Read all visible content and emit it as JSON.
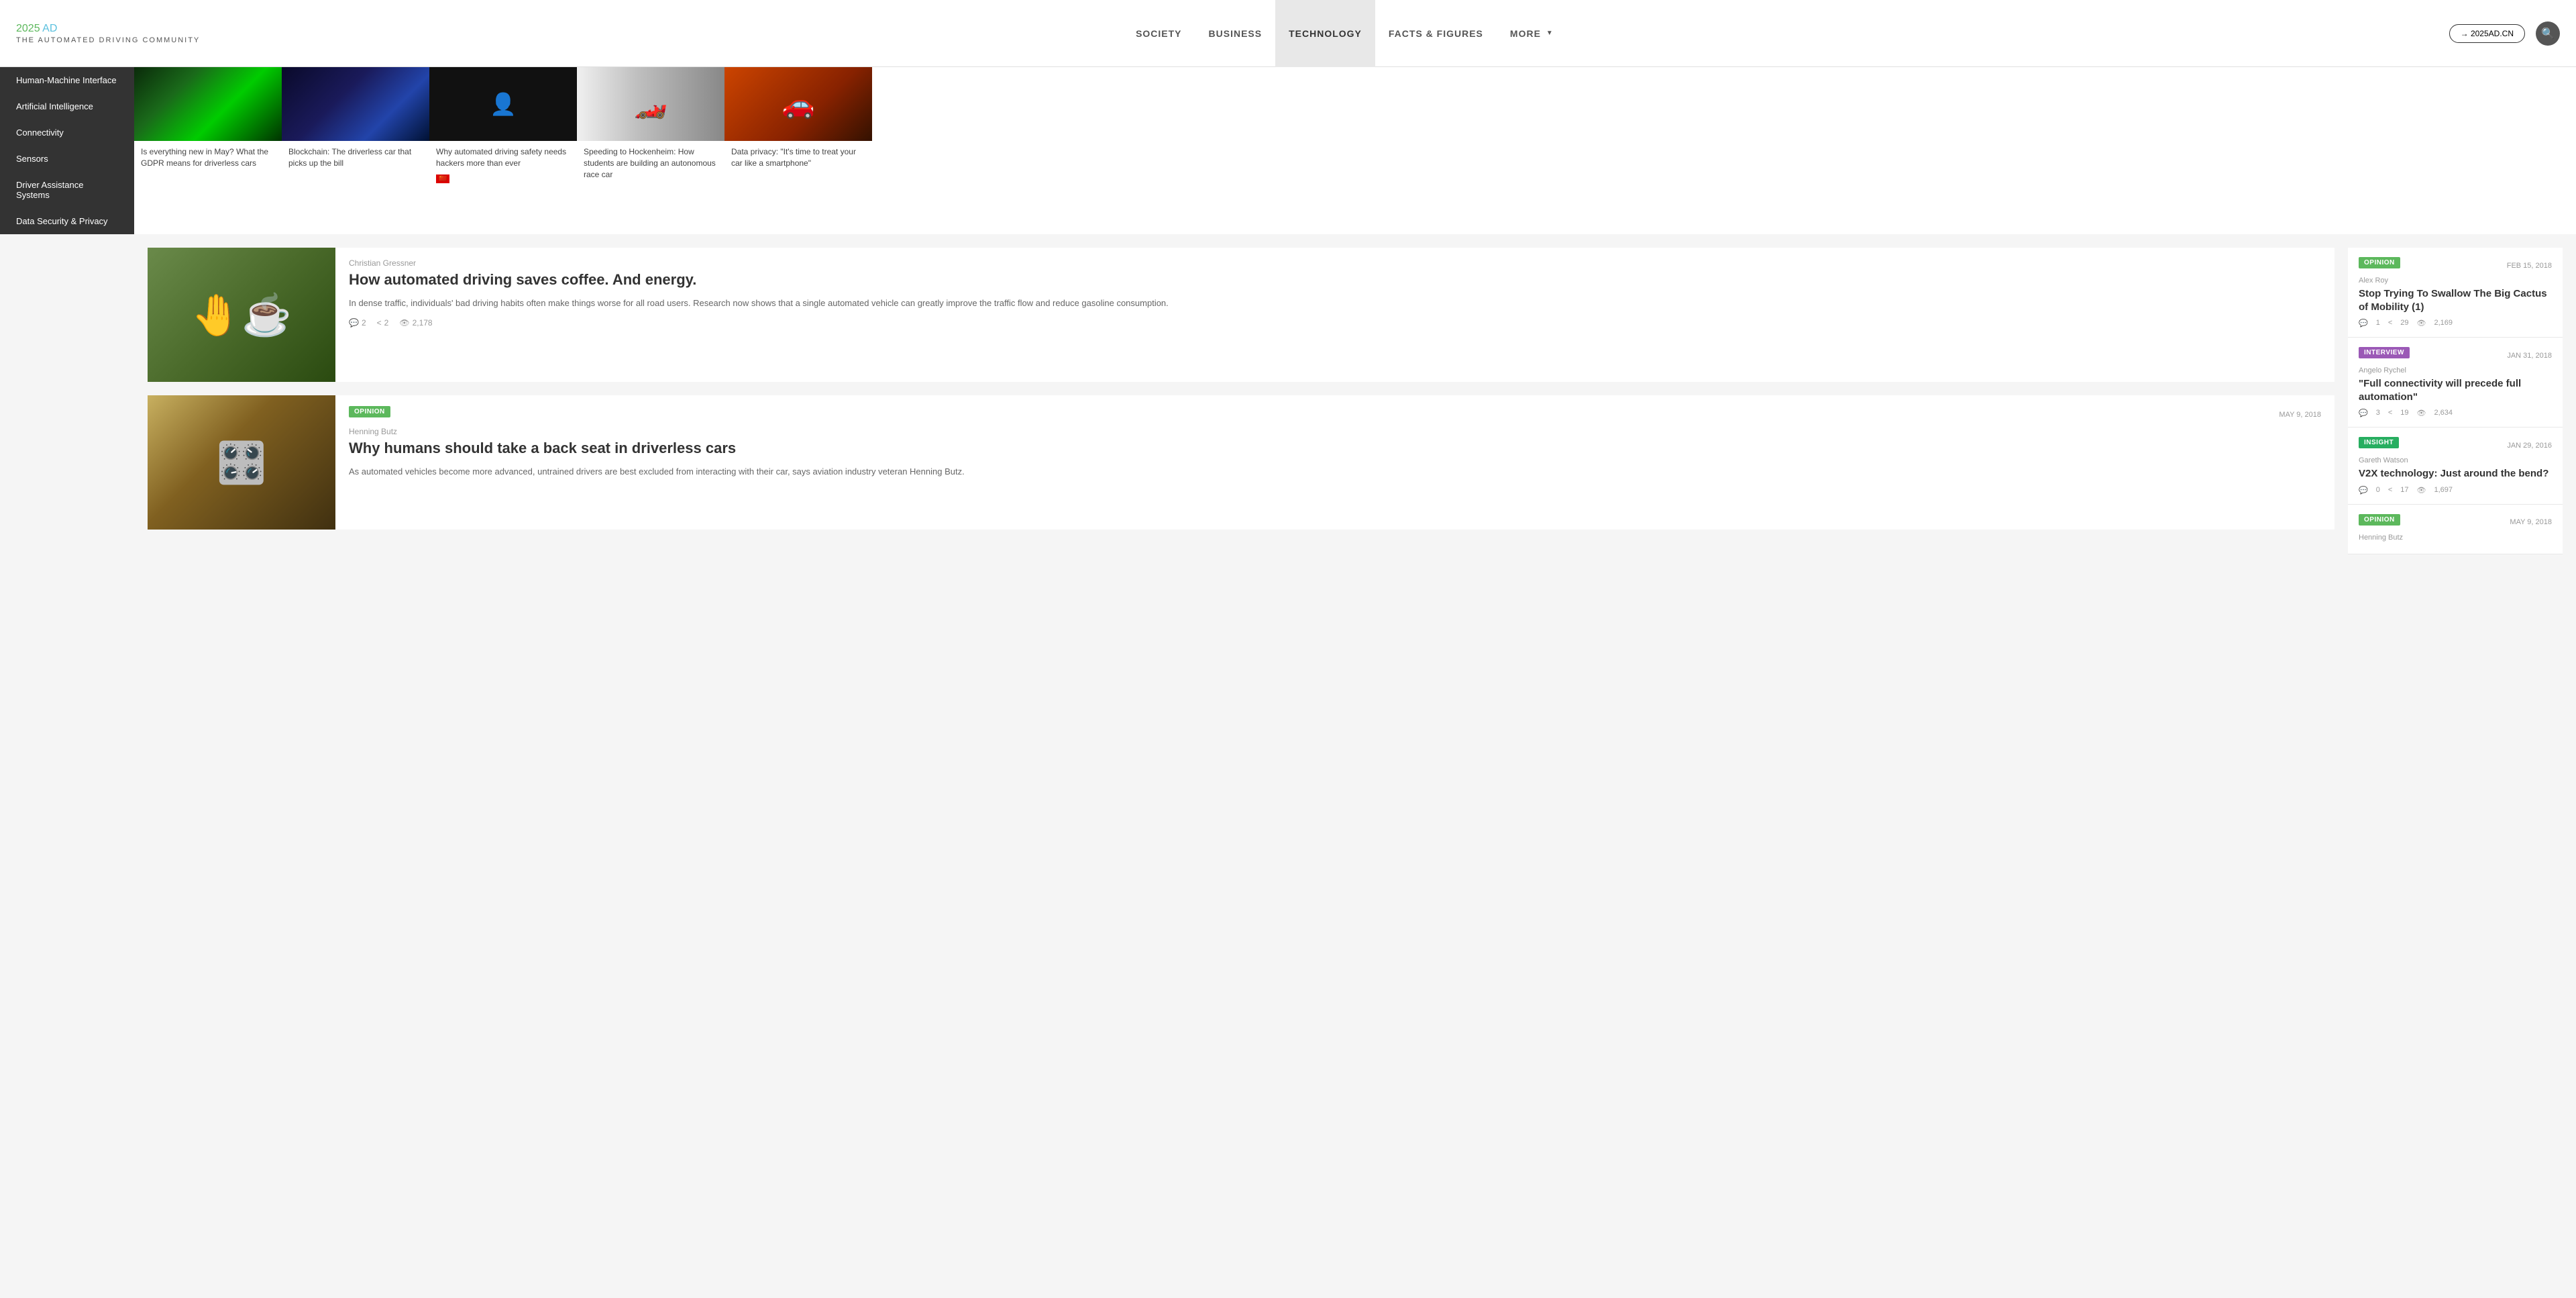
{
  "header": {
    "logo": {
      "numbers": "2025",
      "letters": "AD",
      "subtitle": "THE AUTOMATED DRIVING COMMUNITY"
    },
    "nav": [
      {
        "id": "society",
        "label": "SOCIETY",
        "active": false
      },
      {
        "id": "business",
        "label": "BUSINESS",
        "active": false
      },
      {
        "id": "technology",
        "label": "TECHNOLOGY",
        "active": true
      },
      {
        "id": "facts",
        "label": "FACTS & FIGURES",
        "active": false
      },
      {
        "id": "more",
        "label": "MORE",
        "active": false,
        "hasDropdown": true
      }
    ],
    "cn_link": "→ 2025AD.CN",
    "search_icon": "🔍"
  },
  "sidebar": {
    "items": [
      {
        "id": "hmi",
        "label": "Human-Machine Interface"
      },
      {
        "id": "ai",
        "label": "Artificial Intelligence"
      },
      {
        "id": "connectivity",
        "label": "Connectivity"
      },
      {
        "id": "sensors",
        "label": "Sensors"
      },
      {
        "id": "driver-assistance",
        "label": "Driver Assistance Systems"
      },
      {
        "id": "data-security",
        "label": "Data Security & Privacy"
      }
    ]
  },
  "featured": [
    {
      "id": "gdpr",
      "imgClass": "img-green",
      "title": "Is everything new in May? What the GDPR means for driverless cars"
    },
    {
      "id": "blockchain",
      "imgClass": "img-cyber",
      "title": "Blockchain: The driverless car that picks up the bill"
    },
    {
      "id": "hackers",
      "imgClass": "img-hacker",
      "title": "Why automated driving safety needs hackers more than ever",
      "hasChinaFlag": true
    },
    {
      "id": "hockenheim",
      "imgClass": "img-race",
      "title": "Speeding to Hockenheim: How students are building an autonomous race car"
    },
    {
      "id": "data-privacy",
      "imgClass": "img-car",
      "title": "Data privacy: \"It's time to treat your car like a smartphone\""
    }
  ],
  "articles": [
    {
      "id": "coffee",
      "imgClass": "img-driving",
      "author": "Christian Gressner",
      "title": "How automated driving saves coffee. And energy.",
      "excerpt": "In dense traffic, individuals' bad driving habits often make things worse for all road users. Research now shows that a single automated vehicle can greatly improve the traffic flow and reduce gasoline consumption.",
      "comments": 2,
      "shares": 2,
      "views": "2,178",
      "tag": null,
      "date": null
    },
    {
      "id": "backseat",
      "imgClass": "img-cockpit",
      "author": "Henning Butz",
      "title": "Why humans should take a back seat in driverless cars",
      "excerpt": "As automated vehicles become more advanced, untrained drivers are best excluded from interacting with their car, says aviation industry veteran Henning Butz.",
      "comments": null,
      "shares": null,
      "views": null,
      "tag": "OPINION",
      "tagClass": "tag-opinion",
      "date": "MAY 9, 2018"
    }
  ],
  "sidebar_articles": [
    {
      "id": "cactus",
      "tag": "OPINION",
      "tagClass": "tag-opinion",
      "date": "FEB 15, 2018",
      "author": "Alex Roy",
      "title": "Stop Trying To Swallow The Big Cactus of Mobility (1)",
      "comments": 1,
      "shares": 29,
      "views": "2,169"
    },
    {
      "id": "connectivity",
      "tag": "INTERVIEW",
      "tagClass": "tag-interview",
      "date": "JAN 31, 2018",
      "author": "Angelo Rychel",
      "title": "\"Full connectivity will precede full automation\"",
      "comments": 3,
      "shares": 19,
      "views": "2,634"
    },
    {
      "id": "v2x",
      "tag": "INSIGHT",
      "tagClass": "tag-insight",
      "date": "JAN 29, 2016",
      "author": "Gareth Watson",
      "title": "V2X technology: Just around the bend?",
      "comments": 0,
      "shares": 17,
      "views": "1,697"
    },
    {
      "id": "humans-backseat",
      "tag": "OPINION",
      "tagClass": "tag-opinion",
      "date": "MAY 9, 2018",
      "author": "Henning Butz",
      "title": "",
      "comments": null,
      "shares": null,
      "views": null
    }
  ]
}
